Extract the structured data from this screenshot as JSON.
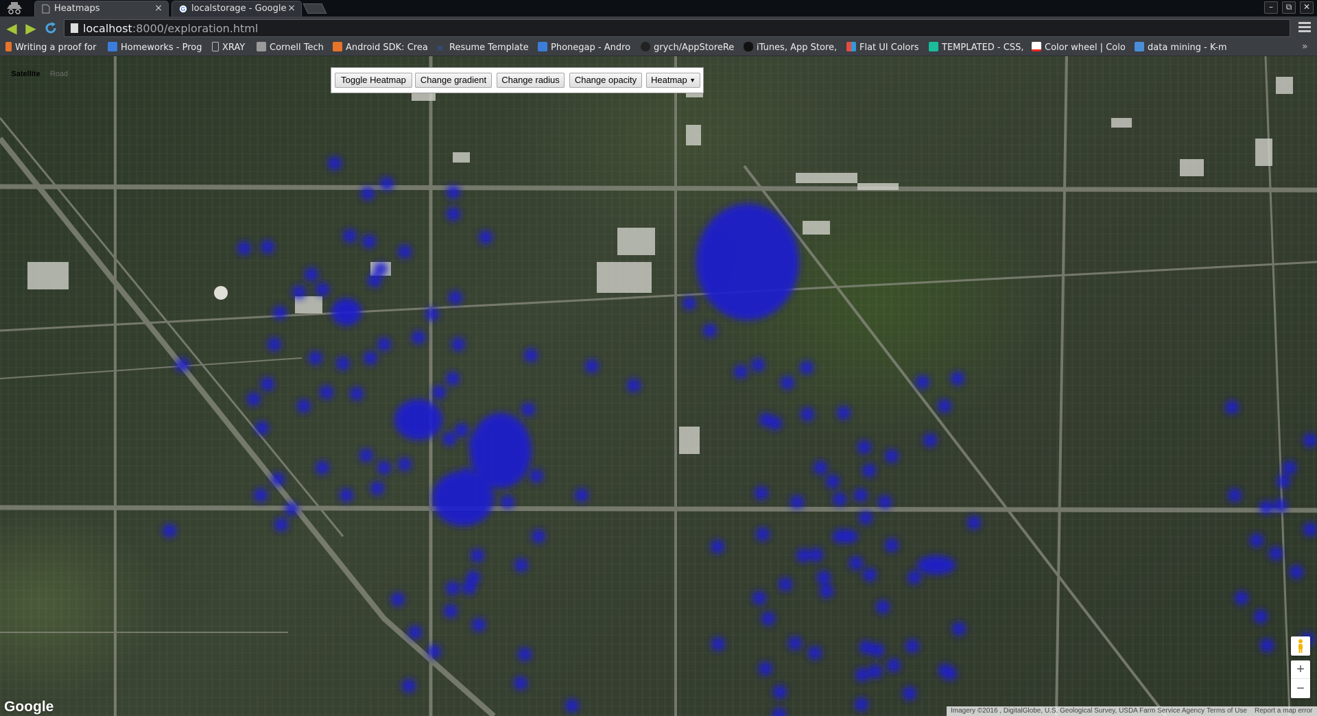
{
  "browser": {
    "tabs": [
      {
        "title": "Heatmaps",
        "active": true
      },
      {
        "title": "localstorage - Google",
        "active": false
      }
    ],
    "url_host": "localhost",
    "url_path": ":8000/exploration.html",
    "bookmarks": [
      {
        "label": "Writing a proof for",
        "icon": "orange-bookmark-icon",
        "color": "#e8732a"
      },
      {
        "label": "Homeworks - Prog",
        "icon": "blue-doc-icon",
        "color": "#3b7dd8"
      },
      {
        "label": "XRAY",
        "icon": "page-icon",
        "color": "#cccccc"
      },
      {
        "label": "Cornell Tech",
        "icon": "folder-icon",
        "color": "#9a9a9a"
      },
      {
        "label": "Android SDK: Crea",
        "icon": "tuts-plus-icon",
        "color": "#e8732a"
      },
      {
        "label": "Resume Template",
        "icon": "x-mark-icon",
        "color": "#2a58a8"
      },
      {
        "label": "Phonegap - Andro",
        "icon": "blue-doc-icon",
        "color": "#3b7dd8"
      },
      {
        "label": "grych/AppStoreRe",
        "icon": "github-icon",
        "color": "#222222"
      },
      {
        "label": "iTunes, App Store,",
        "icon": "apple-icon",
        "color": "#111111"
      },
      {
        "label": "Flat UI Colors",
        "icon": "flat-ui-icon",
        "color": "#e74c3c"
      },
      {
        "label": "TEMPLATED - CSS,",
        "icon": "templated-icon",
        "color": "#1abc9c"
      },
      {
        "label": "Color wheel | Colo",
        "icon": "adobe-icon",
        "color": "#ffffff"
      },
      {
        "label": "data mining - K-m",
        "icon": "stackexchange-icon",
        "color": "#4a8ed8"
      }
    ]
  },
  "map": {
    "maptype": {
      "satellite": "Satellite",
      "road": "Road",
      "selected": "Satellite"
    },
    "controls": {
      "toggle_heatmap": "Toggle Heatmap",
      "change_gradient": "Change gradient",
      "change_radius": "Change radius",
      "change_opacity": "Change opacity",
      "layer_select": "Heatmap"
    },
    "logo": "Google",
    "zoom_in": "+",
    "zoom_out": "−",
    "attribution": "Imagery ©2016 , DigitalGlobe, U.S. Geological Survey, USDA Farm Service Agency",
    "terms": "Terms of Use",
    "report": "Report a map error",
    "heatmap_color": "#1e1ed2"
  }
}
